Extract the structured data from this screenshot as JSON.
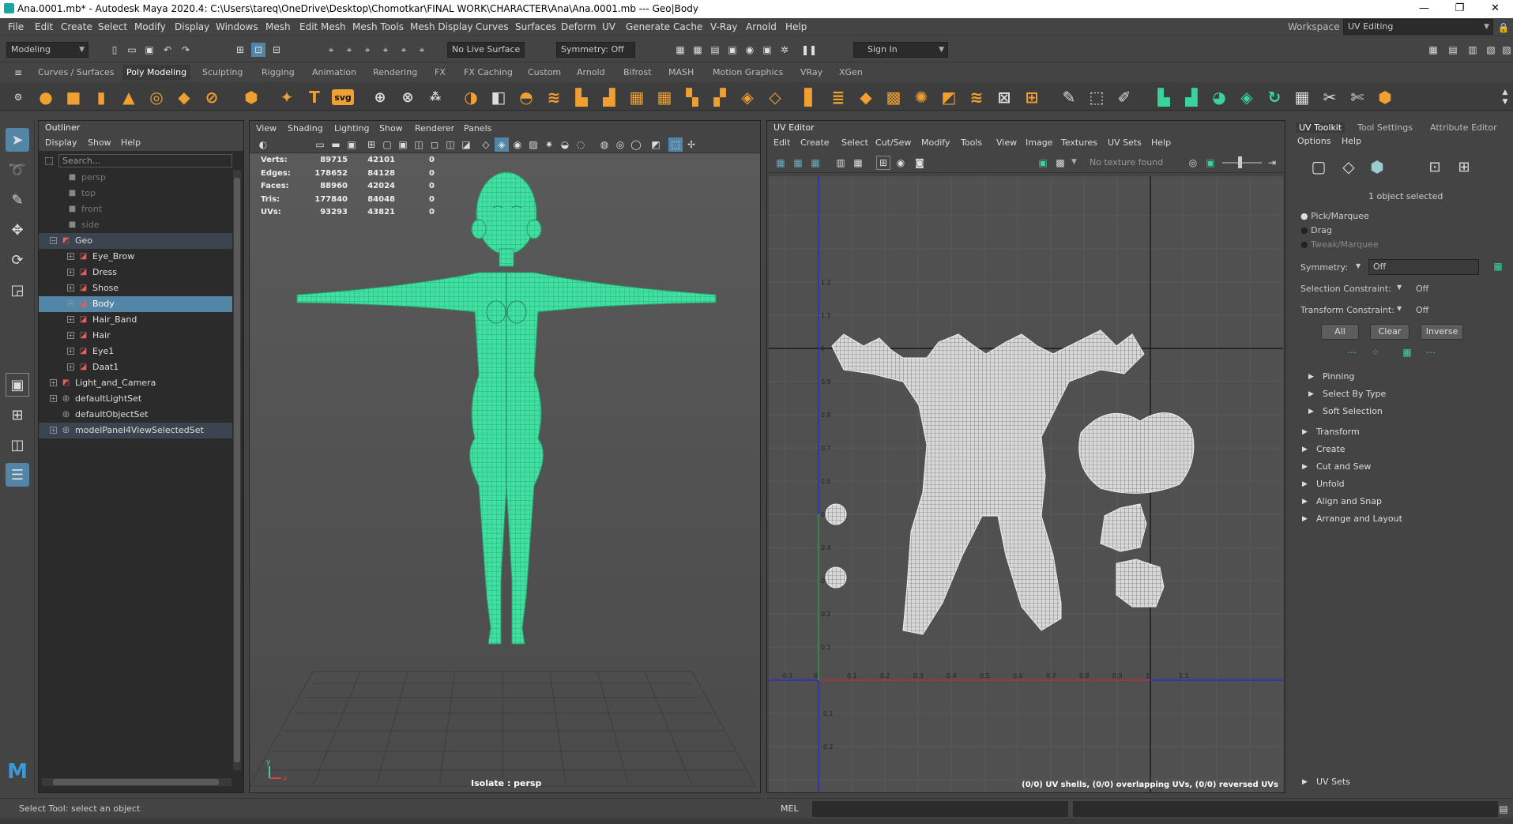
{
  "window": {
    "title": "Ana.0001.mb* - Autodesk Maya 2020.4: C:\\Users\\tareq\\OneDrive\\Desktop\\Chomotkar\\FINAL WORK\\CHARACTER\\Ana\\Ana.0001.mb  ---  Geo|Body",
    "minimize": "—",
    "maximize": "❐",
    "close": "✕"
  },
  "menubar": {
    "items": [
      "File",
      "Edit",
      "Create",
      "Select",
      "Modify",
      "Display",
      "Windows",
      "Mesh",
      "Edit Mesh",
      "Mesh Tools",
      "Mesh Display",
      "Curves",
      "Surfaces",
      "Deform",
      "UV",
      "Generate",
      "Cache",
      "V-Ray",
      "Arnold",
      "Help"
    ],
    "workspace_label": "Workspace :",
    "workspace_value": "UV Editing"
  },
  "statusline": {
    "mode": "Modeling",
    "live_surface": "No Live Surface",
    "symmetry": "Symmetry: Off",
    "sign_in": "Sign In"
  },
  "shelf": {
    "tabs": [
      "Curves / Surfaces",
      "Poly Modeling",
      "Sculpting",
      "Rigging",
      "Animation",
      "Rendering",
      "FX",
      "FX Caching",
      "Custom",
      "Arnold",
      "Bifrost",
      "MASH",
      "Motion Graphics",
      "VRay",
      "XGen"
    ],
    "active_tab": "Poly Modeling",
    "svg_label": "svg"
  },
  "outliner": {
    "title": "Outliner",
    "menu": [
      "Display",
      "Show",
      "Help"
    ],
    "search_placeholder": "Search...",
    "rows": [
      {
        "label": "persp",
        "icon": "camera-icon",
        "dim": true
      },
      {
        "label": "top",
        "icon": "camera-icon",
        "dim": true
      },
      {
        "label": "front",
        "icon": "camera-icon",
        "dim": true
      },
      {
        "label": "side",
        "icon": "camera-icon",
        "dim": true
      },
      {
        "label": "Geo",
        "icon": "group-icon"
      },
      {
        "label": "Eye_Brow",
        "icon": "mesh-icon"
      },
      {
        "label": "Dress",
        "icon": "mesh-icon"
      },
      {
        "label": "Shose",
        "icon": "mesh-icon"
      },
      {
        "label": "Body",
        "icon": "mesh-icon"
      },
      {
        "label": "Hair_Band",
        "icon": "mesh-icon"
      },
      {
        "label": "Hair",
        "icon": "mesh-icon"
      },
      {
        "label": "Eye1",
        "icon": "mesh-icon"
      },
      {
        "label": "Daat1",
        "icon": "mesh-icon"
      },
      {
        "label": "Light_and_Camera",
        "icon": "group-icon"
      },
      {
        "label": "defaultLightSet",
        "icon": "set-icon"
      },
      {
        "label": "defaultObjectSet",
        "icon": "set-icon"
      },
      {
        "label": "modelPanel4ViewSelectedSet",
        "icon": "set-icon"
      }
    ]
  },
  "viewport": {
    "menu": [
      "View",
      "Shading",
      "Lighting",
      "Show",
      "Renderer",
      "Panels"
    ],
    "hud": [
      {
        "label": "Verts:",
        "a": "89715",
        "b": "42101",
        "c": "0"
      },
      {
        "label": "Edges:",
        "a": "178652",
        "b": "84128",
        "c": "0"
      },
      {
        "label": "Faces:",
        "a": "88960",
        "b": "42024",
        "c": "0"
      },
      {
        "label": "Tris:",
        "a": "177840",
        "b": "84048",
        "c": "0"
      },
      {
        "label": "UVs:",
        "a": "93293",
        "b": "43821",
        "c": "0"
      }
    ],
    "camera_label": "Isolate : persp",
    "axis_y": "y",
    "axis_x": "x"
  },
  "uv_editor": {
    "title": "UV Editor",
    "menu": [
      "Edit",
      "Create",
      "Select",
      "Cut/Sew",
      "Modify",
      "Tools",
      "View",
      "Image",
      "Textures",
      "UV Sets",
      "Help"
    ],
    "texture_status": "No texture found",
    "status": "(0/0) UV shells, (0/0) overlapping UVs, (0/0) reversed UVs",
    "x_ticks": [
      "-0.1",
      "0",
      "0.1",
      "0.2",
      "0.3",
      "0.4",
      "0.5",
      "0.6",
      "0.7",
      "0.8",
      "0.9",
      "1",
      "1.1"
    ],
    "y_ticks": [
      "1.2",
      "1.1",
      "1",
      "0.9",
      "0.8",
      "0.7",
      "0.6",
      "0.5",
      "0.4",
      "0.3",
      "0.2",
      "0.1",
      "-0.1",
      "-0.2"
    ]
  },
  "toolkit": {
    "tabs": [
      "UV Toolkit",
      "Tool Settings",
      "Attribute Editor"
    ],
    "menu": [
      "Options",
      "Help"
    ],
    "selected_info": "1 object selected",
    "pick_modes": [
      "Pick/Marquee",
      "Drag",
      "Tweak/Marquee"
    ],
    "symmetry_label": "Symmetry:",
    "symmetry_value": "Off",
    "selection_constraint_label": "Selection Constraint:",
    "selection_constraint_value": "Off",
    "transform_constraint_label": "Transform Constraint:",
    "transform_constraint_value": "Off",
    "buttons": [
      "All",
      "Clear",
      "Inverse"
    ],
    "subsections": [
      "Pinning",
      "Select By Type",
      "Soft Selection"
    ],
    "sections": [
      "Transform",
      "Create",
      "Cut and Sew",
      "Unfold",
      "Align and Snap",
      "Arrange and Layout"
    ],
    "uv_sets": "UV Sets"
  },
  "helpline": {
    "text": "Select Tool: select an object",
    "mel": "MEL"
  }
}
